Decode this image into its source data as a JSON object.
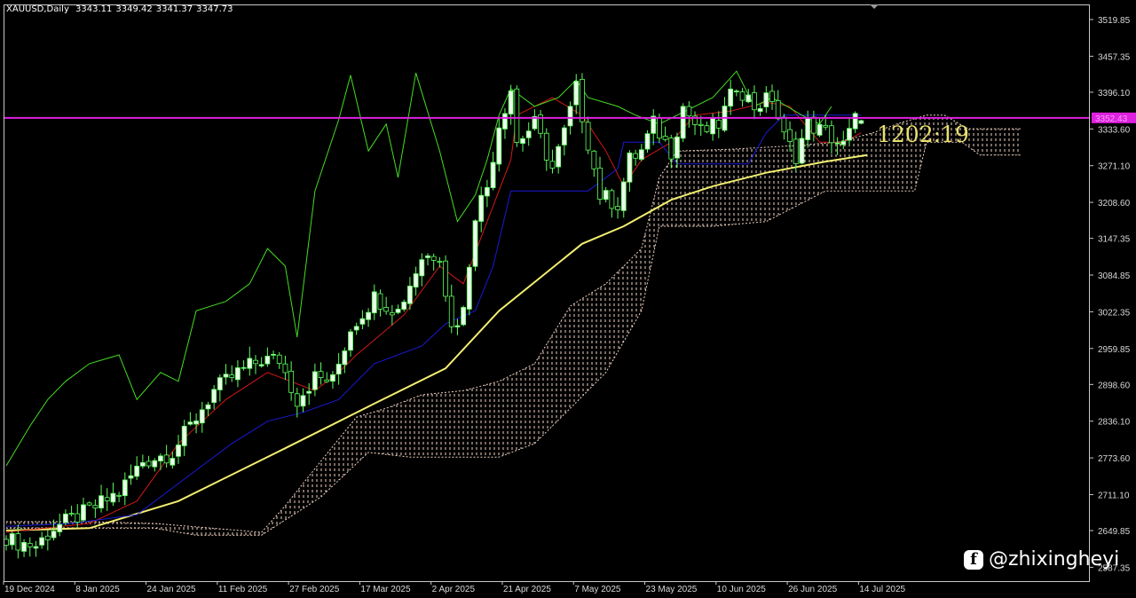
{
  "header": {
    "symbol": "XAUUSD,Daily",
    "open": "3343.11",
    "high": "3349.42",
    "low": "3341.37",
    "close": "3347.73"
  },
  "timer": "1202:19",
  "watermark": {
    "icon": "facebook-icon",
    "text": "@zhixingheyi"
  },
  "colors": {
    "bull": "#eaffea",
    "bear": "#000000",
    "wick": "#5cff5c",
    "tenkan": "#d01818",
    "kijun": "#1a1ad8",
    "lagging": "#44dd22",
    "ma": "#f2ee70",
    "cloud": "#f0d2c2",
    "price_line": "#e020e0",
    "timer": "#e8e070"
  },
  "chart_data": {
    "type": "candlestick",
    "title": "XAUUSD,Daily",
    "ylim": [
      2587.35,
      3540
    ],
    "x_unit": "trading-day index",
    "y_ticks": [
      "3519.85",
      "3457.35",
      "3396.10",
      "3333.60",
      "3271.10",
      "3208.60",
      "3147.35",
      "3084.85",
      "3022.35",
      "2959.85",
      "2898.60",
      "2836.10",
      "2773.60",
      "2711.10",
      "2649.85",
      "2587.35"
    ],
    "x_ticks": [
      {
        "bar": 0,
        "label": "19 Dec 2024"
      },
      {
        "bar": 12,
        "label": "8 Jan 2025"
      },
      {
        "bar": 24,
        "label": "24 Jan 2025"
      },
      {
        "bar": 36,
        "label": "11 Feb 2025"
      },
      {
        "bar": 48,
        "label": "27 Feb 2025"
      },
      {
        "bar": 60,
        "label": "17 Mar 2025"
      },
      {
        "bar": 72,
        "label": "2 Apr 2025"
      },
      {
        "bar": 84,
        "label": "21 Apr 2025"
      },
      {
        "bar": 96,
        "label": "7 May 2025"
      },
      {
        "bar": 108,
        "label": "23 May 2025"
      },
      {
        "bar": 120,
        "label": "10 Jun 2025"
      },
      {
        "bar": 132,
        "label": "26 Jun 2025"
      },
      {
        "bar": 144,
        "label": "14 Jul 2025"
      }
    ],
    "current_price": "3352.43",
    "last_candle": {
      "open": 3343.11,
      "high": 3349.42,
      "low": 3341.37,
      "close": 3347.73
    },
    "close_path": [
      [
        0,
        2640
      ],
      [
        1,
        2632
      ],
      [
        5,
        2624
      ],
      [
        8,
        2654
      ],
      [
        14,
        2684
      ],
      [
        19,
        2715
      ],
      [
        23,
        2768
      ],
      [
        28,
        2783
      ],
      [
        32,
        2843
      ],
      [
        35,
        2888
      ],
      [
        39,
        2919
      ],
      [
        43,
        2941
      ],
      [
        46,
        2941
      ],
      [
        49,
        2873
      ],
      [
        52,
        2911
      ],
      [
        55,
        2904
      ],
      [
        58,
        2994
      ],
      [
        62,
        3047
      ],
      [
        66,
        3024
      ],
      [
        70,
        3115
      ],
      [
        73,
        3122
      ],
      [
        75,
        2994
      ],
      [
        77,
        3024
      ],
      [
        79,
        3191
      ],
      [
        81,
        3236
      ],
      [
        83,
        3342
      ],
      [
        85,
        3402
      ],
      [
        86,
        3311
      ],
      [
        89,
        3342
      ],
      [
        92,
        3266
      ],
      [
        94,
        3327
      ],
      [
        96,
        3402
      ],
      [
        98,
        3311
      ],
      [
        100,
        3221
      ],
      [
        103,
        3206
      ],
      [
        105,
        3281
      ],
      [
        107,
        3296
      ],
      [
        109,
        3342
      ],
      [
        112,
        3296
      ],
      [
        114,
        3372
      ],
      [
        117,
        3327
      ],
      [
        120,
        3342
      ],
      [
        123,
        3410
      ],
      [
        126,
        3372
      ],
      [
        129,
        3387
      ],
      [
        131,
        3319
      ],
      [
        133,
        3289
      ],
      [
        135,
        3342
      ],
      [
        138,
        3327
      ],
      [
        141,
        3304
      ],
      [
        143,
        3349
      ],
      [
        144,
        3347.73
      ]
    ],
    "series": [
      {
        "name": "moving-average",
        "color_key": "ma",
        "points": [
          [
            0,
            2650
          ],
          [
            14,
            2654
          ],
          [
            29,
            2700
          ],
          [
            47,
            2790
          ],
          [
            62,
            2866
          ],
          [
            74,
            2926
          ],
          [
            83,
            3024
          ],
          [
            97,
            3138
          ],
          [
            104,
            3168
          ],
          [
            112,
            3213
          ],
          [
            119,
            3236
          ],
          [
            128,
            3259
          ],
          [
            138,
            3278
          ],
          [
            145,
            3289
          ]
        ]
      },
      {
        "name": "tenkan-sen",
        "color_key": "tenkan",
        "points": [
          [
            0,
            2647
          ],
          [
            14,
            2662
          ],
          [
            22,
            2700
          ],
          [
            29,
            2798
          ],
          [
            37,
            2873
          ],
          [
            44,
            2919
          ],
          [
            52,
            2888
          ],
          [
            56,
            2919
          ],
          [
            59,
            2949
          ],
          [
            67,
            3017
          ],
          [
            73,
            3100
          ],
          [
            77,
            3070
          ],
          [
            81,
            3176
          ],
          [
            85,
            3281
          ],
          [
            86,
            3357
          ],
          [
            92,
            3387
          ],
          [
            97,
            3357
          ],
          [
            101,
            3296
          ],
          [
            104,
            3236
          ],
          [
            107,
            3281
          ],
          [
            112,
            3311
          ],
          [
            116,
            3357
          ],
          [
            122,
            3364
          ],
          [
            128,
            3379
          ],
          [
            132,
            3372
          ],
          [
            137,
            3311
          ],
          [
            141,
            3311
          ],
          [
            144,
            3327
          ]
        ]
      },
      {
        "name": "kijun-sen",
        "color_key": "kijun",
        "points": [
          [
            0,
            2657
          ],
          [
            11,
            2662
          ],
          [
            22,
            2677
          ],
          [
            29,
            2730
          ],
          [
            38,
            2798
          ],
          [
            44,
            2836
          ],
          [
            50,
            2851
          ],
          [
            56,
            2873
          ],
          [
            62,
            2934
          ],
          [
            70,
            2964
          ],
          [
            74,
            3002
          ],
          [
            79,
            3024
          ],
          [
            82,
            3100
          ],
          [
            85,
            3228
          ],
          [
            98,
            3228
          ],
          [
            103,
            3266
          ],
          [
            104,
            3311
          ],
          [
            110,
            3311
          ],
          [
            113,
            3274
          ],
          [
            125,
            3274
          ],
          [
            128,
            3327
          ],
          [
            131,
            3357
          ],
          [
            144,
            3357
          ]
        ]
      },
      {
        "name": "lagging-span",
        "color_key": "lagging",
        "points": [
          [
            0,
            2760
          ],
          [
            4,
            2828
          ],
          [
            7,
            2873
          ],
          [
            10,
            2904
          ],
          [
            14,
            2934
          ],
          [
            19,
            2949
          ],
          [
            22,
            2873
          ],
          [
            26,
            2919
          ],
          [
            29,
            2904
          ],
          [
            32,
            3024
          ],
          [
            37,
            3040
          ],
          [
            41,
            3070
          ],
          [
            44,
            3130
          ],
          [
            47,
            3100
          ],
          [
            49,
            2979
          ],
          [
            52,
            3228
          ],
          [
            56,
            3349
          ],
          [
            58,
            3425
          ],
          [
            61,
            3296
          ],
          [
            64,
            3342
          ],
          [
            66,
            3251
          ],
          [
            69,
            3429
          ],
          [
            73,
            3296
          ],
          [
            76,
            3176
          ],
          [
            79,
            3221
          ],
          [
            81,
            3281
          ],
          [
            83,
            3357
          ],
          [
            85,
            3402
          ],
          [
            89,
            3372
          ],
          [
            93,
            3387
          ],
          [
            96,
            3417
          ],
          [
            98,
            3387
          ],
          [
            103,
            3372
          ],
          [
            106,
            3357
          ],
          [
            110,
            3342
          ],
          [
            113,
            3357
          ],
          [
            119,
            3387
          ],
          [
            123,
            3432
          ],
          [
            126,
            3372
          ],
          [
            129,
            3387
          ],
          [
            134,
            3357
          ],
          [
            137,
            3342
          ],
          [
            139,
            3372
          ]
        ]
      }
    ],
    "cloud": {
      "upper": [
        [
          0,
          2665
        ],
        [
          14,
          2665
        ],
        [
          25,
          2662
        ],
        [
          43,
          2647
        ],
        [
          47,
          2692
        ],
        [
          53,
          2768
        ],
        [
          59,
          2843
        ],
        [
          64,
          2858
        ],
        [
          70,
          2881
        ],
        [
          77,
          2888
        ],
        [
          83,
          2904
        ],
        [
          89,
          2934
        ],
        [
          95,
          3032
        ],
        [
          101,
          3070
        ],
        [
          107,
          3130
        ],
        [
          110,
          3251
        ],
        [
          113,
          3296
        ],
        [
          122,
          3299
        ],
        [
          131,
          3304
        ],
        [
          140,
          3311
        ],
        [
          146,
          3327
        ],
        [
          150,
          3342
        ],
        [
          155,
          3357
        ],
        [
          158,
          3357
        ],
        [
          162,
          3334
        ],
        [
          171,
          3334
        ]
      ],
      "lower": [
        [
          0,
          2654
        ],
        [
          25,
          2654
        ],
        [
          32,
          2642
        ],
        [
          43,
          2642
        ],
        [
          53,
          2707
        ],
        [
          61,
          2783
        ],
        [
          68,
          2775
        ],
        [
          83,
          2775
        ],
        [
          89,
          2798
        ],
        [
          95,
          2858
        ],
        [
          101,
          2919
        ],
        [
          107,
          3024
        ],
        [
          110,
          3168
        ],
        [
          119,
          3168
        ],
        [
          128,
          3176
        ],
        [
          138,
          3228
        ],
        [
          153,
          3228
        ],
        [
          155,
          3311
        ],
        [
          161,
          3311
        ],
        [
          164,
          3289
        ],
        [
          171,
          3289
        ]
      ]
    }
  }
}
